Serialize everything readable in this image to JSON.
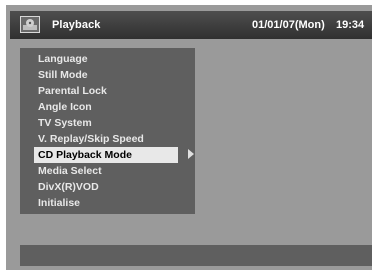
{
  "title_bar": {
    "icon": "disc-player-icon",
    "title": "Playback",
    "date": "01/01/07(Mon)",
    "time": "19:34"
  },
  "menu": {
    "items": [
      {
        "label": "Language"
      },
      {
        "label": "Still Mode"
      },
      {
        "label": "Parental Lock"
      },
      {
        "label": "Angle Icon"
      },
      {
        "label": "TV System"
      },
      {
        "label": "V. Replay/Skip Speed"
      },
      {
        "label": "CD Playback Mode",
        "selected": true
      },
      {
        "label": "Media Select"
      },
      {
        "label": "DivX(R)VOD"
      },
      {
        "label": "Initialise"
      }
    ],
    "selected_arrow_icon": "right-arrow-icon"
  },
  "colors": {
    "background": "#9a9a9a",
    "title_bar": "#3a3a3a",
    "panel": "#5f5f5f",
    "selected_bg": "#e8e8e8",
    "text": "#e8e8e8"
  }
}
